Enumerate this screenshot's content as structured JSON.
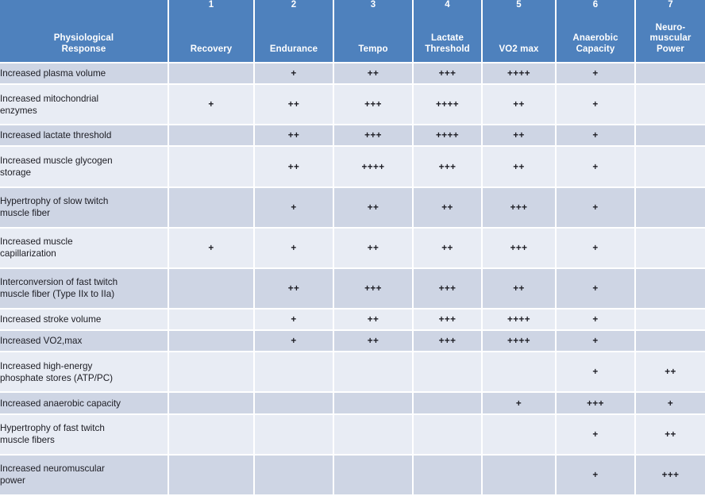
{
  "table": {
    "columns": [
      {
        "num": "",
        "label": "Physiological\nResponse",
        "label_lines": [
          "Physiological",
          "Response"
        ]
      },
      {
        "num": "1",
        "label": "Recovery",
        "label_lines": [
          "Recovery"
        ]
      },
      {
        "num": "2",
        "label": "Endurance",
        "label_lines": [
          "Endurance"
        ]
      },
      {
        "num": "3",
        "label": "Tempo",
        "label_lines": [
          "Tempo"
        ]
      },
      {
        "num": "4",
        "label": "Lactate Threshold",
        "label_lines": [
          "Lactate",
          "Threshold"
        ]
      },
      {
        "num": "5",
        "label": "VO2 max",
        "label_lines": [
          "VO2 max"
        ]
      },
      {
        "num": "6",
        "label": "Anaerobic Capacity",
        "label_lines": [
          "Anaerobic",
          "Capacity"
        ]
      },
      {
        "num": "7",
        "label": "Neuro-muscular Power",
        "label_lines": [
          "Neuro-",
          "muscular",
          "Power"
        ]
      }
    ],
    "rows": [
      {
        "label": "Increased plasma volume",
        "label_lines": [
          "Increased plasma volume"
        ],
        "values": [
          "",
          "+",
          "++",
          "+++",
          "++++",
          "+",
          ""
        ]
      },
      {
        "label": "Increased mitochondrial enzymes",
        "label_lines": [
          "Increased mitochondrial",
          "enzymes"
        ],
        "values": [
          "+",
          "++",
          "+++",
          "++++",
          "++",
          "+",
          ""
        ]
      },
      {
        "label": "Increased lactate threshold",
        "label_lines": [
          "Increased lactate threshold"
        ],
        "values": [
          "",
          "++",
          "+++",
          "++++",
          "++",
          "+",
          ""
        ]
      },
      {
        "label": "Increased muscle glycogen storage",
        "label_lines": [
          "Increased muscle glycogen",
          "storage"
        ],
        "values": [
          "",
          "++",
          "++++",
          "+++",
          "++",
          "+",
          ""
        ]
      },
      {
        "label": "Hypertrophy of slow twitch muscle fiber",
        "label_lines": [
          "Hypertrophy of slow twitch",
          "muscle fiber"
        ],
        "values": [
          "",
          "+",
          "++",
          "++",
          "+++",
          "+",
          ""
        ]
      },
      {
        "label": "Increased muscle capillarization",
        "label_lines": [
          "Increased muscle",
          "capillarization"
        ],
        "values": [
          "+",
          "+",
          "++",
          "++",
          "+++",
          "+",
          ""
        ]
      },
      {
        "label": "Interconversion of fast twitch muscle fiber (Type IIx to IIa)",
        "label_lines": [
          "Interconversion of fast twitch",
          "muscle fiber (Type IIx to IIa)"
        ],
        "values": [
          "",
          "++",
          "+++",
          "+++",
          "++",
          "+",
          ""
        ]
      },
      {
        "label": "Increased stroke volume",
        "label_lines": [
          "Increased stroke volume"
        ],
        "values": [
          "",
          "+",
          "++",
          "+++",
          "++++",
          "+",
          ""
        ]
      },
      {
        "label": "Increased VO2,max",
        "label_lines": [
          "Increased VO2,max"
        ],
        "values": [
          "",
          "+",
          "++",
          "+++",
          "++++",
          "+",
          ""
        ]
      },
      {
        "label": "Increased high-energy phosphate stores (ATP/PC)",
        "label_lines": [
          "Increased high-energy",
          "phosphate stores (ATP/PC)"
        ],
        "values": [
          "",
          "",
          "",
          "",
          "",
          "+",
          "++"
        ]
      },
      {
        "label": "Increased anaerobic capacity",
        "label_lines": [
          "Increased anaerobic capacity"
        ],
        "values": [
          "",
          "",
          "",
          "",
          "+",
          "+++",
          "+"
        ]
      },
      {
        "label": "Hypertrophy of fast twitch muscle fibers",
        "label_lines": [
          "Hypertrophy of fast twitch",
          "muscle fibers"
        ],
        "values": [
          "",
          "",
          "",
          "",
          "",
          "+",
          "++"
        ]
      },
      {
        "label": "Increased neuromuscular power",
        "label_lines": [
          "Increased neuromuscular",
          "power"
        ],
        "values": [
          "",
          "",
          "",
          "",
          "",
          "+",
          "+++"
        ]
      }
    ]
  },
  "colors": {
    "header_blue": "#4e81bd",
    "row_dark": "#ced5e4",
    "row_light": "#e8ecf4",
    "grid_line": "#ffffff",
    "header_text": "#ffffff",
    "body_text": "#1d1d24"
  }
}
